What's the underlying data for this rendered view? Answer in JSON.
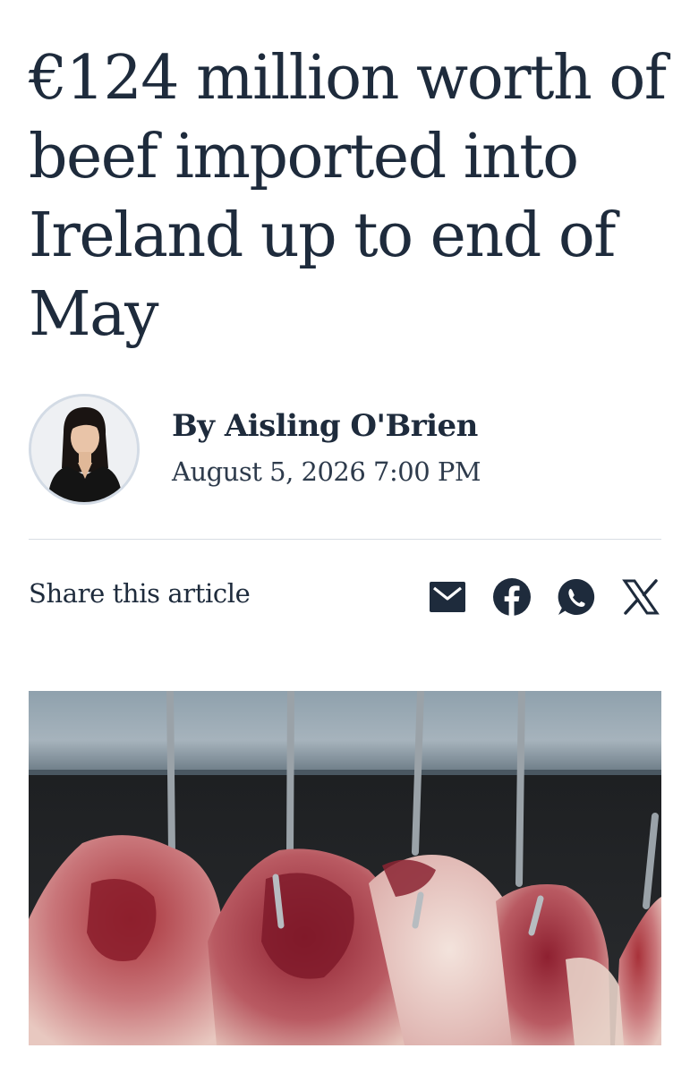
{
  "article": {
    "headline": "€124 million worth of beef imported into Ireland up to end of May",
    "author": "By Aisling O'Brien",
    "date": "August 5, 2026 7:00 PM"
  },
  "share": {
    "label": "Share this article",
    "icons": [
      "email-icon",
      "facebook-icon",
      "whatsapp-icon",
      "x-icon"
    ]
  },
  "colors": {
    "text": "#1e2b3c",
    "divider": "#d8dde3",
    "avatar_ring": "#d3dbe5"
  }
}
